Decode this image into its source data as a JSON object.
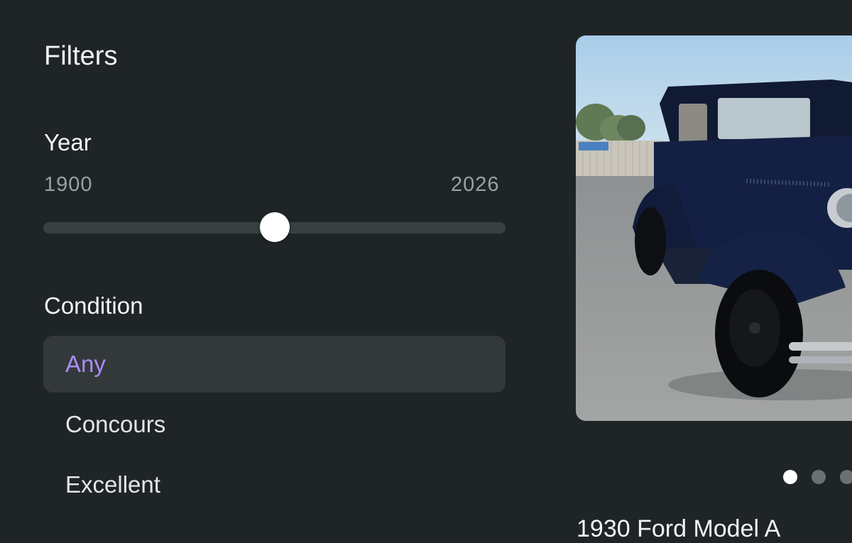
{
  "filters": {
    "title": "Filters",
    "year": {
      "label": "Year",
      "min_label": "1900",
      "max_label": "2026",
      "min": 1900,
      "max": 2026,
      "value_fraction": 0.5
    },
    "condition": {
      "label": "Condition",
      "options": [
        {
          "label": "Any",
          "selected": true
        },
        {
          "label": "Concours",
          "selected": false
        },
        {
          "label": "Excellent",
          "selected": false
        }
      ]
    }
  },
  "listing": {
    "photo_icon": "vintage-car-photo",
    "carousel": {
      "count": 3,
      "active_index": 0
    },
    "title_partial": "1930 Ford Model A"
  },
  "colors": {
    "background": "#1f2526",
    "selected_bg": "#33383b",
    "accent": "#a98cf1",
    "muted_text": "#9aa1a2",
    "track": "#394042"
  }
}
